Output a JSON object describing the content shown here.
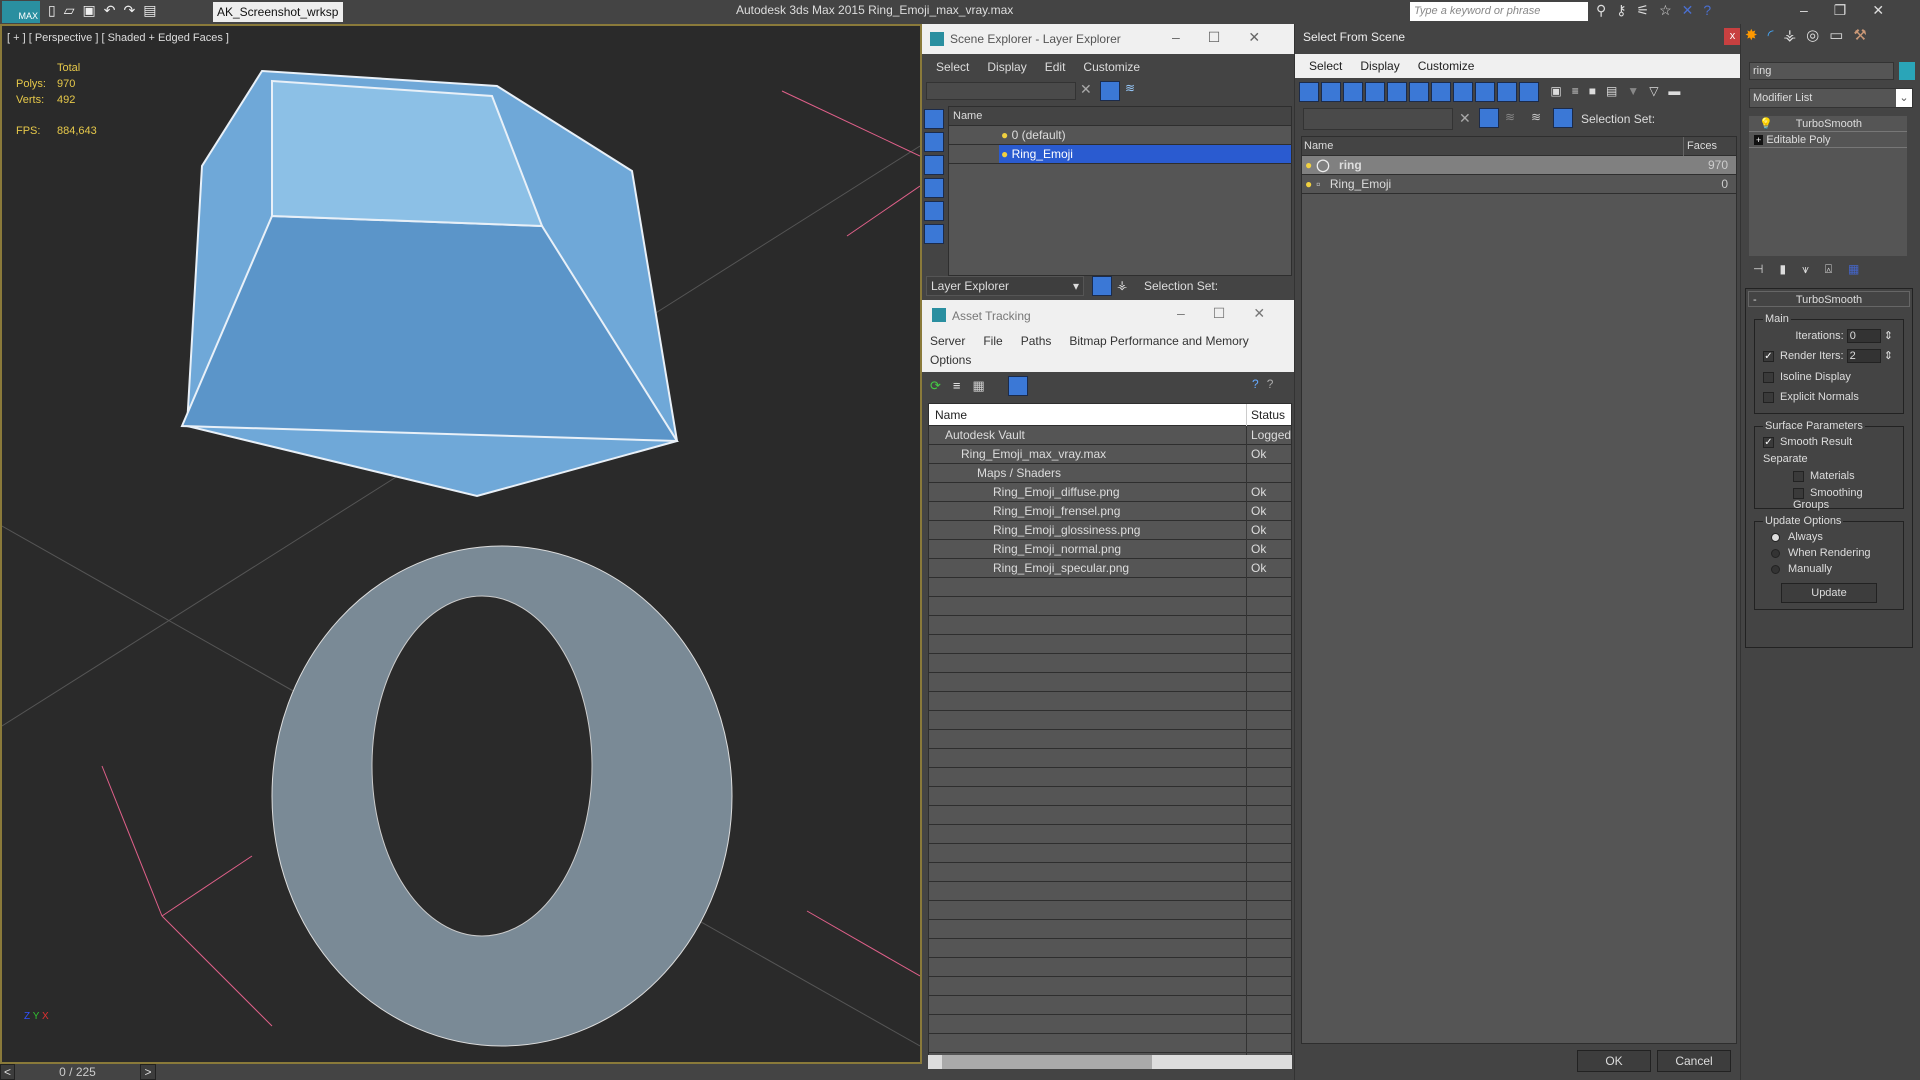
{
  "titlebar": {
    "workspace": "AK_Screenshot_wrksp",
    "app_title": "Autodesk 3ds Max  2015     Ring_Emoji_max_vray.max",
    "search_placeholder": "Type a keyword or phrase"
  },
  "viewport": {
    "label": "[ + ] [ Perspective ] [ Shaded + Edged Faces ]",
    "stats_header": "Total",
    "polys_label": "Polys:",
    "polys": "970",
    "verts_label": "Verts:",
    "verts": "492",
    "fps_label": "FPS:",
    "fps": "884,643",
    "axis_x": "X",
    "axis_y": "Y",
    "axis_z": "Z"
  },
  "timeline": {
    "frame": "0 / 225",
    "prev": "<",
    "next": ">"
  },
  "scene_explorer": {
    "title": "Scene Explorer - Layer Explorer",
    "menu": [
      "Select",
      "Display",
      "Edit",
      "Customize"
    ],
    "col_name": "Name",
    "rows": [
      {
        "name": "0 (default)"
      },
      {
        "name": "Ring_Emoji",
        "selected": true
      }
    ],
    "footer_dropdown": "Layer Explorer",
    "selection_set": "Selection Set:"
  },
  "asset_tracking": {
    "title": "Asset Tracking",
    "menu": [
      "Server",
      "File",
      "Paths",
      "Bitmap Performance and Memory",
      "Options"
    ],
    "col_name": "Name",
    "col_status": "Status",
    "rows": [
      {
        "name": "Autodesk Vault",
        "status": "Logged",
        "indent": 1
      },
      {
        "name": "Ring_Emoji_max_vray.max",
        "status": "Ok",
        "indent": 2
      },
      {
        "name": "Maps / Shaders",
        "status": "",
        "indent": 3
      },
      {
        "name": "Ring_Emoji_diffuse.png",
        "status": "Ok",
        "indent": 4
      },
      {
        "name": "Ring_Emoji_frensel.png",
        "status": "Ok",
        "indent": 4
      },
      {
        "name": "Ring_Emoji_glossiness.png",
        "status": "Ok",
        "indent": 4
      },
      {
        "name": "Ring_Emoji_normal.png",
        "status": "Ok",
        "indent": 4
      },
      {
        "name": "Ring_Emoji_specular.png",
        "status": "Ok",
        "indent": 4
      }
    ]
  },
  "select_from_scene": {
    "title": "Select From Scene",
    "close": "x",
    "menu": [
      "Select",
      "Display",
      "Customize"
    ],
    "selection_set": "Selection Set:",
    "col_name": "Name",
    "col_faces": "Faces",
    "rows": [
      {
        "name": "ring",
        "faces": "970",
        "selected": true
      },
      {
        "name": "Ring_Emoji",
        "faces": "0"
      }
    ],
    "ok": "OK",
    "cancel": "Cancel"
  },
  "command_panel": {
    "object_name": "ring",
    "object_color": "#2aa5b8",
    "modifier_list": "Modifier List",
    "stack": [
      "TurboSmooth",
      "Editable Poly"
    ],
    "rollout_title": "TurboSmooth",
    "main_group": "Main",
    "iterations_label": "Iterations:",
    "iterations": "0",
    "render_iters_label": "Render Iters:",
    "render_iters": "2",
    "render_iters_checked": true,
    "isoline": "Isoline Display",
    "explicit_normals": "Explicit Normals",
    "surface_group": "Surface Parameters",
    "smooth_result": "Smooth Result",
    "separate": "Separate",
    "materials": "Materials",
    "smoothing_groups": "Smoothing Groups",
    "update_group": "Update Options",
    "always": "Always",
    "when_rendering": "When Rendering",
    "manually": "Manually",
    "update_btn": "Update"
  }
}
